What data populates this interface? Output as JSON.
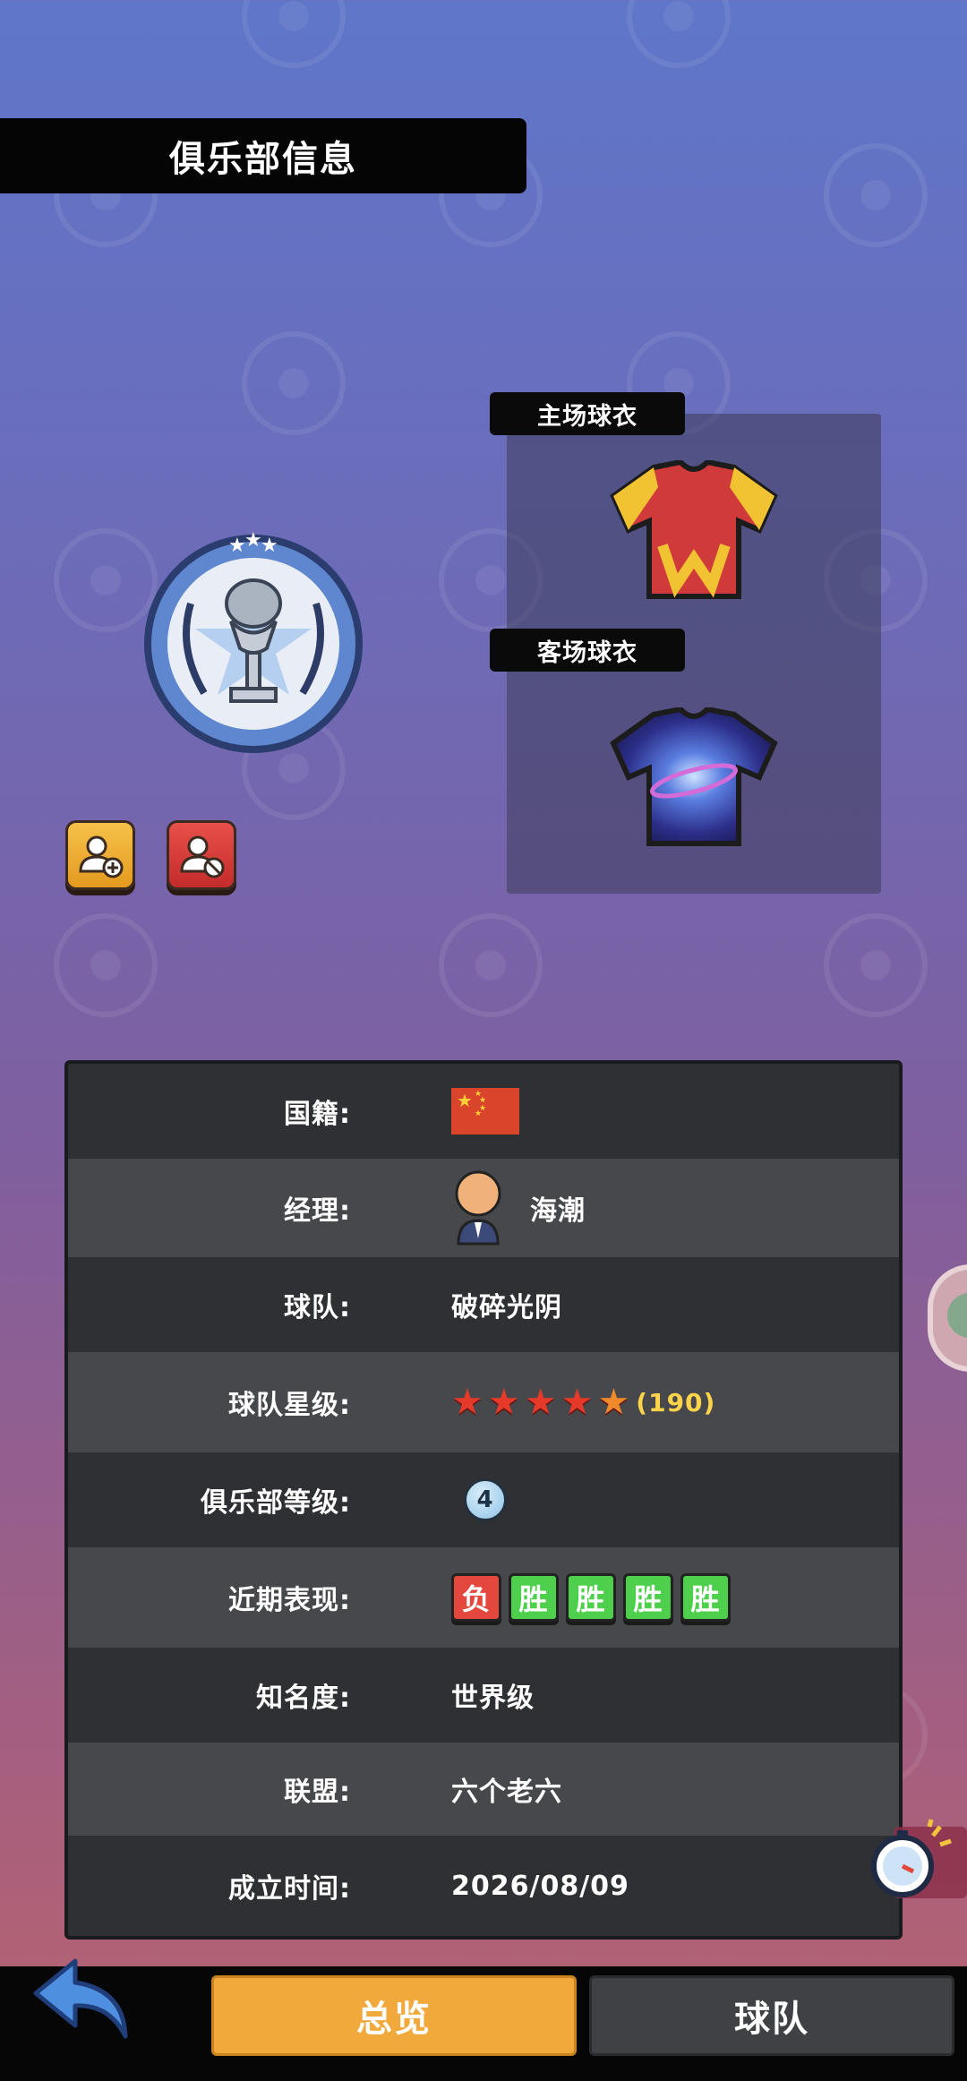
{
  "header": {
    "title": "俱乐部信息"
  },
  "kits": {
    "home_label": "主场球衣",
    "away_label": "客场球衣"
  },
  "actions": {
    "add_friend_icon": "add-friend-icon",
    "remove_friend_icon": "remove-friend-icon"
  },
  "info": {
    "nationality": {
      "label": "国籍:",
      "flag": "china-flag-icon"
    },
    "manager": {
      "label": "经理:",
      "name": "海潮"
    },
    "team": {
      "label": "球队:",
      "value": "破碎光阴"
    },
    "stars": {
      "label": "球队星级:",
      "rating": 4.5,
      "max": 5,
      "count": "(190)"
    },
    "club_level": {
      "label": "俱乐部等级:",
      "value": "4"
    },
    "recent_form": {
      "label": "近期表现:",
      "results": [
        "负",
        "胜",
        "胜",
        "胜",
        "胜"
      ]
    },
    "fame": {
      "label": "知名度:",
      "value": "世界级"
    },
    "alliance": {
      "label": "联盟:",
      "value": "六个老六"
    },
    "founded": {
      "label": "成立时间:",
      "value": "2026/08/09"
    }
  },
  "tabs": {
    "overview": "总览",
    "team": "球队",
    "active": "overview"
  },
  "colors": {
    "accent": "#f2a93b",
    "loss": "#e4473c",
    "win": "#4fd04c",
    "star": "#e53a2a"
  }
}
